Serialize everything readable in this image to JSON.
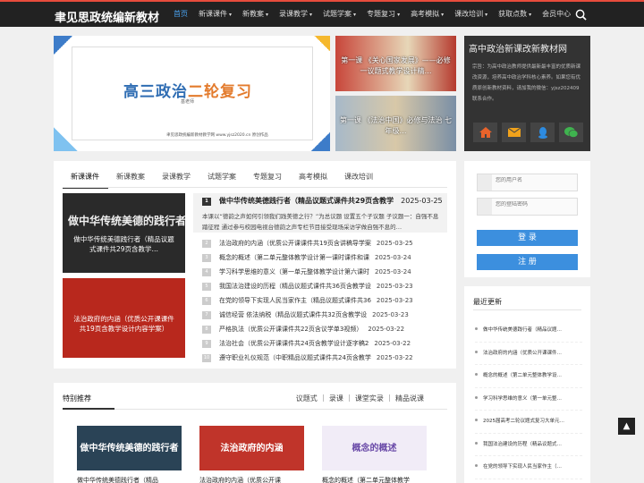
{
  "header": {
    "site_title": "聿见思政统编新教材",
    "nav": [
      {
        "label": "首页",
        "caret": false,
        "active": true
      },
      {
        "label": "新课课件",
        "caret": true
      },
      {
        "label": "新教案",
        "caret": true
      },
      {
        "label": "录课教学",
        "caret": true
      },
      {
        "label": "试题学案",
        "caret": true
      },
      {
        "label": "专题复习",
        "caret": true
      },
      {
        "label": "高考模拟",
        "caret": true
      },
      {
        "label": "课改培训",
        "caret": true
      },
      {
        "label": "获取点数",
        "caret": true
      },
      {
        "label": "会员中心",
        "caret": false
      }
    ],
    "caret_glyph": "▾"
  },
  "banner": {
    "title_a": "高三政治",
    "title_b": "二轮复习",
    "author": "基老师",
    "footer": "聿见思政统编新教材教学网 www.yjsz2020.cn 原创作品"
  },
  "minis": [
    {
      "caption": "第一课 《关心国家发展》——必修一议题式教学设计精…"
    },
    {
      "caption": "第一课 《法治中国》必修与法治 七年级…"
    }
  ],
  "profile": {
    "title": "高中政治新课改新教材网",
    "text": "宗旨：为高中政治教师提供最新最丰富的优质新课改资源，培养高中政治学科核心素养。如果您有优质原创新教材资料，请加我的微信：yjsz202409 联系合作。"
  },
  "main": {
    "tabs": [
      "新课课件",
      "新课教案",
      "录课教学",
      "试题学案",
      "专题复习",
      "高考模拟",
      "课改培训"
    ],
    "thumb1": {
      "big": "做中华传统美德的践行者",
      "caption": "做中华传统美德践行者（精品议题式课件共29页含教学…"
    },
    "thumb2": {
      "caption": "法治政府的内涵（优质公开课课件共19页含教学设计内容学案）"
    },
    "featured": {
      "num": "1",
      "title": "做中华传统美德践行者（精品议题式课件共29页含教学",
      "date": "2025-03-25",
      "desc": "本课以“德韵之声如何引领我们践美德之行？”为总议题 设置五个子议题 子议题一：自强不息踏征程 通过参与校园电视台德韵之声专栏节目接受现场采访学做自强不息的…"
    },
    "rows": [
      {
        "num": "2",
        "title": "法治政府的内涵（优质公开课课件共19页含讲稿导学案",
        "date": "2025-03-25"
      },
      {
        "num": "3",
        "title": "概念的概述（第二单元整体教学设计第一课时课件和课",
        "date": "2025-03-24"
      },
      {
        "num": "4",
        "title": "学习科学思维的意义（第一单元整体教学设计第六课时",
        "date": "2025-03-24"
      },
      {
        "num": "5",
        "title": "我国法治建设的历程（精品议题式课件共36页含教学设",
        "date": "2025-03-23"
      },
      {
        "num": "6",
        "title": "在党的领导下实现人民当家作主（精品议题式课件共36",
        "date": "2025-03-23"
      },
      {
        "num": "7",
        "title": "诚信经营 依法纳税（精品议题式课件共32页含教学设",
        "date": "2025-03-23"
      },
      {
        "num": "8",
        "title": "严格执法（优质公开课课件共22页含议学单3视频）",
        "date": "2025-03-22"
      },
      {
        "num": "9",
        "title": "法治社会（优质公开课课件共24页含教学设计逐字稿2",
        "date": "2025-03-22"
      },
      {
        "num": "10",
        "title": "遵守职业礼仪规范（中职精品议题式课件共24页含教学",
        "date": "2025-03-22"
      }
    ]
  },
  "special": {
    "heading": "特别推荐",
    "links": "议题式 ｜ 录课 ｜ 课堂实录 ｜ 精品说课",
    "cards": [
      {
        "title": "做中华传统美德践行者（精品",
        "img_text": "做中华传统美德的践行者",
        "bg": "#2a4356"
      },
      {
        "title": "法治政府的内涵（优质公开课",
        "img_text": "法治政府的内涵",
        "bg": "#c0342a"
      },
      {
        "title": "概念的概述（第二单元整体教学",
        "img_text": "概念的概述",
        "bg": "#f1ecf7"
      }
    ]
  },
  "login": {
    "user_placeholder": "您的用户名",
    "pass_placeholder": "您的登陆密码",
    "login_label": "登 录",
    "register_label": "注 册"
  },
  "recent": {
    "heading": "最近更新",
    "items": [
      "做中华传统美德践行者（精品议题…",
      "法治政府的内涵（优质公开课课件…",
      "概念的概述（第二单元整体教学设…",
      "学习科学思维的意义（第一单元整…",
      "2025届高考二轮议题式复习大单元…",
      "我国法治建设的历程（精品议题式…",
      "在党的领导下实现人民当家作主（…"
    ]
  },
  "colors": {
    "accent": "#3c8fde",
    "nav_active": "#4aa3f0",
    "topbar": "#222222"
  }
}
